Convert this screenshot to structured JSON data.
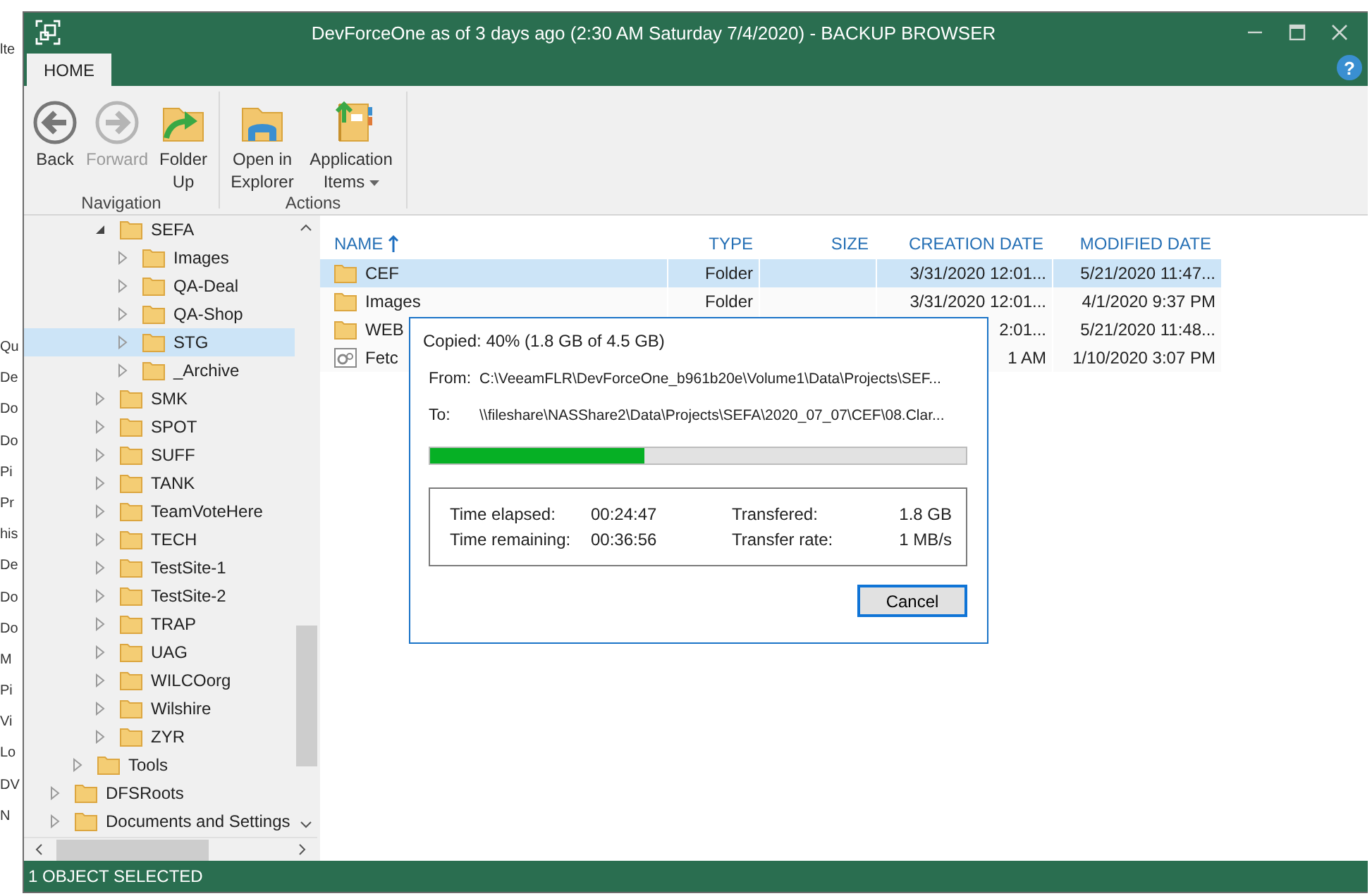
{
  "background_fragments": {
    "top": "lte",
    "side": [
      "Qu",
      "De",
      "Do",
      "Do",
      "Pi",
      "Pr",
      "his",
      "De",
      "Do",
      "Do",
      "M",
      "Pi",
      "Vi",
      "Lo",
      "DV",
      "N"
    ]
  },
  "window": {
    "title": "DevForceOne as of 3 days ago (2:30 AM Saturday 7/4/2020) - BACKUP BROWSER",
    "help": "?"
  },
  "tabs": [
    {
      "label": "HOME",
      "selected": true
    }
  ],
  "ribbon": {
    "groups": [
      {
        "label": "Navigation",
        "buttons": [
          {
            "kind": "back",
            "label": "Back",
            "disabled": false,
            "dropdown": false
          },
          {
            "kind": "forward",
            "label": "Forward",
            "disabled": true,
            "dropdown": false
          },
          {
            "kind": "folder-up",
            "label": "Folder Up",
            "disabled": false,
            "dropdown": false
          }
        ]
      },
      {
        "label": "Actions",
        "buttons": [
          {
            "kind": "explorer",
            "label": "Open in Explorer",
            "disabled": false,
            "dropdown": false
          },
          {
            "kind": "app-items",
            "label": "Application Items",
            "disabled": false,
            "dropdown": true
          }
        ]
      }
    ]
  },
  "tree": [
    {
      "children": [
        {
          "children": [
            {
              "label": "SEFA",
              "expanded": true,
              "selected": false,
              "children": [
                {
                  "label": "Images",
                  "expanded": false,
                  "selected": false
                },
                {
                  "label": "QA-Deal",
                  "expanded": false,
                  "selected": false
                },
                {
                  "label": "QA-Shop",
                  "expanded": false,
                  "selected": false
                },
                {
                  "label": "STG",
                  "expanded": false,
                  "selected": true
                },
                {
                  "label": "_Archive",
                  "expanded": false,
                  "selected": false
                }
              ]
            },
            {
              "label": "SMK",
              "expanded": false,
              "selected": false
            },
            {
              "label": "SPOT",
              "expanded": false,
              "selected": false
            },
            {
              "label": "SUFF",
              "expanded": false,
              "selected": false
            },
            {
              "label": "TANK",
              "expanded": false,
              "selected": false
            },
            {
              "label": "TeamVoteHere",
              "expanded": false,
              "selected": false
            },
            {
              "label": "TECH",
              "expanded": false,
              "selected": false
            },
            {
              "label": "TestSite-1",
              "expanded": false,
              "selected": false
            },
            {
              "label": "TestSite-2",
              "expanded": false,
              "selected": false
            },
            {
              "label": "TRAP",
              "expanded": false,
              "selected": false
            },
            {
              "label": "UAG",
              "expanded": false,
              "selected": false
            },
            {
              "label": "WILCOorg",
              "expanded": false,
              "selected": false
            },
            {
              "label": "Wilshire",
              "expanded": false,
              "selected": false
            },
            {
              "label": "ZYR",
              "expanded": false,
              "selected": false
            }
          ]
        },
        {
          "label": "Tools",
          "expanded": false,
          "selected": false
        }
      ]
    },
    {
      "label": "DFSRoots",
      "expanded": false,
      "selected": false
    },
    {
      "label": "Documents and Settings",
      "expanded": false,
      "selected": false
    }
  ],
  "table": {
    "columns": [
      {
        "label": "NAME",
        "sorted": true
      },
      {
        "label": "TYPE",
        "sorted": false
      },
      {
        "label": "SIZE",
        "sorted": false
      },
      {
        "label": "CREATION DATE",
        "sorted": false
      },
      {
        "label": "MODIFIED DATE",
        "sorted": false
      }
    ],
    "rows": [
      {
        "kind": "folder",
        "selected": true,
        "cells": [
          "CEF",
          "Folder",
          "",
          "3/31/2020 12:01...",
          "5/21/2020 11:47..."
        ]
      },
      {
        "kind": "folder",
        "selected": false,
        "cells": [
          "Images",
          "Folder",
          "",
          "3/31/2020 12:01...",
          "4/1/2020 9:37 PM"
        ]
      },
      {
        "kind": "folder",
        "selected": false,
        "cells": [
          "WEB",
          "",
          "",
          "2:01...",
          "5/21/2020 11:48..."
        ]
      },
      {
        "kind": "file",
        "selected": false,
        "cells": [
          "Fetc",
          "",
          "",
          "1 AM",
          "1/10/2020 3:07 PM"
        ]
      }
    ]
  },
  "dialog": {
    "title": "Copied: 40% (1.8 GB of 4.5 GB)",
    "from_label": "From:",
    "from": "C:\\VeeamFLR\\DevForceOne_b961b20e\\Volume1\\Data\\Projects\\SEF...",
    "to_label": "To:",
    "to": "\\\\fileshare\\NASShare2\\Data\\Projects\\SEFA\\2020_07_07\\CEF\\08.Clar...",
    "progress": {
      "level": 0.4
    },
    "stats": [
      {
        "label": "Time elapsed:",
        "value": "00:24:47"
      },
      {
        "label": "Transfered:",
        "value": "1.8 GB"
      },
      {
        "label": "Time remaining:",
        "value": "00:36:56"
      },
      {
        "label": "Transfer rate:",
        "value": "1 MB/s"
      }
    ],
    "button": "Cancel"
  },
  "status_bar": "1 OBJECT SELECTED"
}
